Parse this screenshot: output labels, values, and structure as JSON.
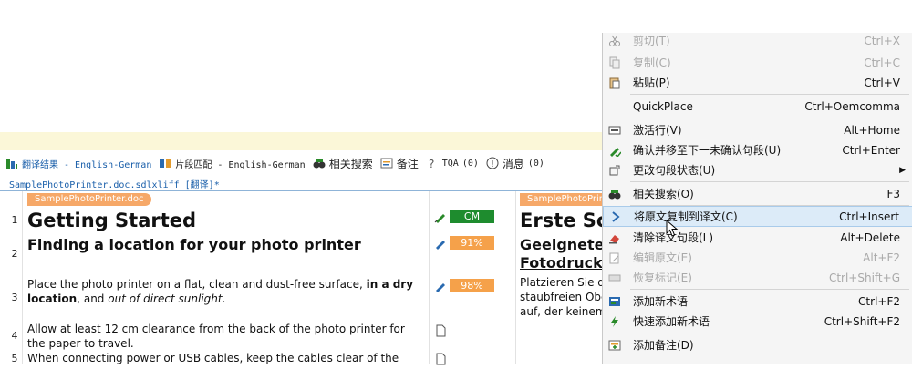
{
  "tabs": [
    {
      "label": "翻译结果 - English-German",
      "icon": "translation-results-icon"
    },
    {
      "label": "片段匹配 - English-German",
      "icon": "fragment-match-icon"
    },
    {
      "label": "相关搜索",
      "icon": "concordance-search-icon"
    },
    {
      "label": "备注",
      "icon": "comments-icon"
    },
    {
      "label": "TQA",
      "count": "(0)",
      "icon": "tqa-icon"
    },
    {
      "label": "消息",
      "count": "(0)",
      "icon": "messages-icon"
    }
  ],
  "file_tab": "SamplePhotoPrinter.doc.sdlxliff [翻译]*",
  "doc_label": "SamplePhotoPrinter.doc",
  "segments": [
    {
      "num": "1",
      "source": "Getting Started",
      "target": "Erste Sc",
      "badge": "CM",
      "badge_color": "#1e8c2e"
    },
    {
      "num": "2",
      "source": "Finding a location for your photo printer",
      "target_l1": "Geeignete",
      "target_l2": "Fotodruck",
      "badge": "91%",
      "badge_color": "#f5a14a"
    },
    {
      "num": "3",
      "source_pre": "Place the photo printer on a flat, clean and dust-free surface, ",
      "source_bold": "in a dry location",
      "source_mid": ", and ",
      "source_italic": "out of direct sunlight",
      "source_end": ".",
      "target_l1": "Platzieren Sie d",
      "target_l2": "staubfreien Obe",
      "target_l3": "auf, der keinem",
      "badge": "98%",
      "badge_color": "#f5a14a"
    },
    {
      "num": "4",
      "source": "Allow at least 12 cm clearance from the back of the photo printer for the paper to travel."
    },
    {
      "num": "5",
      "source": "When connecting power or USB cables, keep the cables clear of the"
    }
  ],
  "menu": [
    {
      "label": "剪切(T)",
      "shortcut": "Ctrl+X",
      "disabled": true,
      "icon": "scissors-icon"
    },
    {
      "label": "复制(C)",
      "shortcut": "Ctrl+C",
      "disabled": true,
      "icon": "copy-icon"
    },
    {
      "label": "粘贴(P)",
      "shortcut": "Ctrl+V",
      "disabled": false,
      "icon": "paste-icon"
    },
    {
      "label": "QuickPlace",
      "shortcut": "Ctrl+Oemcomma",
      "disabled": false,
      "icon": "none"
    },
    {
      "label": "激活行(V)",
      "shortcut": "Alt+Home",
      "disabled": false,
      "icon": "activate-row-icon"
    },
    {
      "label": "确认并移至下一未确认句段(U)",
      "shortcut": "Ctrl+Enter",
      "disabled": false,
      "icon": "confirm-icon"
    },
    {
      "label": "更改句段状态(U)",
      "shortcut": "",
      "disabled": false,
      "icon": "segment-status-icon",
      "submenu": true
    },
    {
      "label": "相关搜索(O)",
      "shortcut": "F3",
      "disabled": false,
      "icon": "concordance-icon"
    },
    {
      "label": "将原文复制到译文(C)",
      "shortcut": "Ctrl+Insert",
      "disabled": false,
      "icon": "copy-source-icon",
      "highlight": true
    },
    {
      "label": "清除译文句段(L)",
      "shortcut": "Alt+Delete",
      "disabled": false,
      "icon": "clear-target-icon"
    },
    {
      "label": "编辑原文(E)",
      "shortcut": "Alt+F2",
      "disabled": true,
      "icon": "edit-source-icon"
    },
    {
      "label": "恢复标记(E)",
      "shortcut": "Ctrl+Shift+G",
      "disabled": true,
      "icon": "restore-tags-icon"
    },
    {
      "label": "添加新术语",
      "shortcut": "Ctrl+F2",
      "disabled": false,
      "icon": "add-term-icon"
    },
    {
      "label": "快速添加新术语",
      "shortcut": "Ctrl+Shift+F2",
      "disabled": false,
      "icon": "quick-add-term-icon"
    },
    {
      "label": "添加备注(D)",
      "shortcut": "",
      "disabled": false,
      "icon": "add-comment-icon"
    }
  ]
}
